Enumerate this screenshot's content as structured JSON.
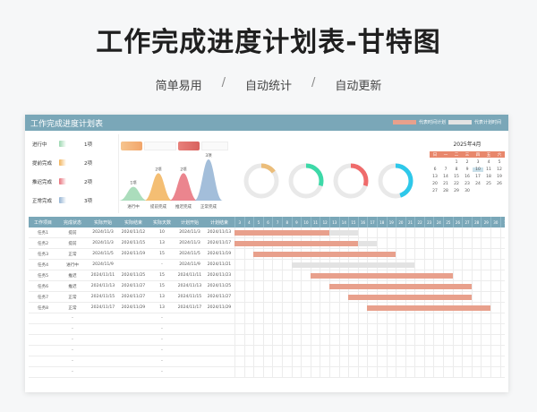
{
  "page_title": "工作完成进度计划表-甘特图",
  "subnav": [
    "简单易用",
    "自动统计",
    "自动更新"
  ],
  "sheet": {
    "title": "工作完成进度计划表",
    "legend_plan": "代表时间计划",
    "legend_actual": "代表计划时间",
    "plan_color": "#e8a08c",
    "actual_color": "#e3e3e3"
  },
  "status": [
    {
      "label": "进行中",
      "count": "1项",
      "color": "#9cd7b0"
    },
    {
      "label": "提前完成",
      "count": "2项",
      "color": "#f2b35a"
    },
    {
      "label": "推迟完成",
      "count": "2项",
      "color": "#e8707a"
    },
    {
      "label": "正常完成",
      "count": "3项",
      "color": "#93b3d3"
    }
  ],
  "bell_chart": {
    "values": [
      "1项",
      "2项",
      "2项",
      "3项"
    ],
    "labels": [
      "进行中",
      "提前完成",
      "推迟完成",
      "正常完成"
    ],
    "colors": [
      "#9cd7b0",
      "#f2b35a",
      "#e8707a",
      "#93b3d3"
    ],
    "values_num": [
      1,
      2,
      2,
      3
    ]
  },
  "donuts": [
    {
      "color": "#ebbd7a",
      "fraction": 0.15
    },
    {
      "color": "#3dd9a8",
      "fraction": 0.3
    },
    {
      "color": "#ef6b6b",
      "fraction": 0.3
    },
    {
      "color": "#2ec8ea",
      "fraction": 0.45
    }
  ],
  "calendar": {
    "title": "2025年4月",
    "weekdays": [
      "日",
      "一",
      "二",
      "三",
      "四",
      "五",
      "六"
    ],
    "days": [
      "",
      "",
      "1",
      "2",
      "3",
      "4",
      "5",
      "6",
      "7",
      "8",
      "9",
      "10",
      "11",
      "12",
      "13",
      "14",
      "15",
      "16",
      "17",
      "18",
      "19",
      "20",
      "21",
      "22",
      "23",
      "24",
      "25",
      "26",
      "27",
      "28",
      "29",
      "30",
      "",
      "",
      ""
    ],
    "today": "10"
  },
  "table": {
    "headers": [
      "工作项目",
      "完成状态",
      "实际开始",
      "实际结束",
      "实际天数",
      "计划开始",
      "计划结束"
    ],
    "day_headers": [
      "3",
      "4",
      "5",
      "6",
      "7",
      "8",
      "9",
      "10",
      "11",
      "12",
      "13",
      "14",
      "15",
      "16",
      "17",
      "18",
      "19",
      "20",
      "21",
      "22",
      "23",
      "24",
      "25",
      "26",
      "27",
      "28",
      "29",
      "30",
      "1",
      "2",
      "3"
    ],
    "rows": [
      {
        "task": "任务1",
        "status": "提前",
        "a_start": "2024/11/3",
        "a_end": "2024/11/12",
        "days": "10",
        "p_start": "2024/11/3",
        "p_end": "2024/11/13",
        "plan": [
          0,
          10
        ],
        "actual": [
          0,
          13
        ]
      },
      {
        "task": "任务2",
        "status": "提前",
        "a_start": "2024/11/3",
        "a_end": "2024/11/15",
        "days": "13",
        "p_start": "2024/11/3",
        "p_end": "2024/11/17",
        "plan": [
          0,
          13
        ],
        "actual": [
          0,
          15
        ]
      },
      {
        "task": "任务3",
        "status": "正常",
        "a_start": "2024/11/5",
        "a_end": "2024/11/19",
        "days": "15",
        "p_start": "2024/11/5",
        "p_end": "2024/11/19",
        "plan": [
          2,
          17
        ],
        "actual": [
          2,
          17
        ]
      },
      {
        "task": "任务4",
        "status": "进行中",
        "a_start": "2024/11/9",
        "a_end": "",
        "days": "-",
        "p_start": "2024/11/9",
        "p_end": "2024/11/21",
        "plan": [
          0,
          0
        ],
        "actual": [
          6,
          19
        ]
      },
      {
        "task": "任务5",
        "status": "推迟",
        "a_start": "2024/11/11",
        "a_end": "2024/11/25",
        "days": "15",
        "p_start": "2024/11/11",
        "p_end": "2024/11/23",
        "plan": [
          8,
          23
        ],
        "actual": [
          8,
          21
        ]
      },
      {
        "task": "任务6",
        "status": "推迟",
        "a_start": "2024/11/13",
        "a_end": "2024/11/27",
        "days": "15",
        "p_start": "2024/11/13",
        "p_end": "2024/11/25",
        "plan": [
          10,
          25
        ],
        "actual": [
          10,
          23
        ]
      },
      {
        "task": "任务7",
        "status": "正常",
        "a_start": "2024/11/15",
        "a_end": "2024/11/27",
        "days": "13",
        "p_start": "2024/11/15",
        "p_end": "2024/11/27",
        "plan": [
          12,
          25
        ],
        "actual": [
          12,
          25
        ]
      },
      {
        "task": "任务8",
        "status": "正常",
        "a_start": "2024/11/17",
        "a_end": "2024/11/29",
        "days": "13",
        "p_start": "2024/11/17",
        "p_end": "2024/11/29",
        "plan": [
          14,
          27
        ],
        "actual": [
          14,
          27
        ]
      },
      {
        "task": "",
        "status": "-",
        "a_start": "",
        "a_end": "",
        "days": "-",
        "p_start": "",
        "p_end": ""
      },
      {
        "task": "",
        "status": "-",
        "a_start": "",
        "a_end": "",
        "days": "-",
        "p_start": "",
        "p_end": ""
      },
      {
        "task": "",
        "status": "-",
        "a_start": "",
        "a_end": "",
        "days": "-",
        "p_start": "",
        "p_end": ""
      },
      {
        "task": "",
        "status": "-",
        "a_start": "",
        "a_end": "",
        "days": "-",
        "p_start": "",
        "p_end": ""
      },
      {
        "task": "",
        "status": "-",
        "a_start": "",
        "a_end": "",
        "days": "-",
        "p_start": "",
        "p_end": ""
      },
      {
        "task": "",
        "status": "-",
        "a_start": "",
        "a_end": "",
        "days": "-",
        "p_start": "",
        "p_end": ""
      }
    ]
  }
}
